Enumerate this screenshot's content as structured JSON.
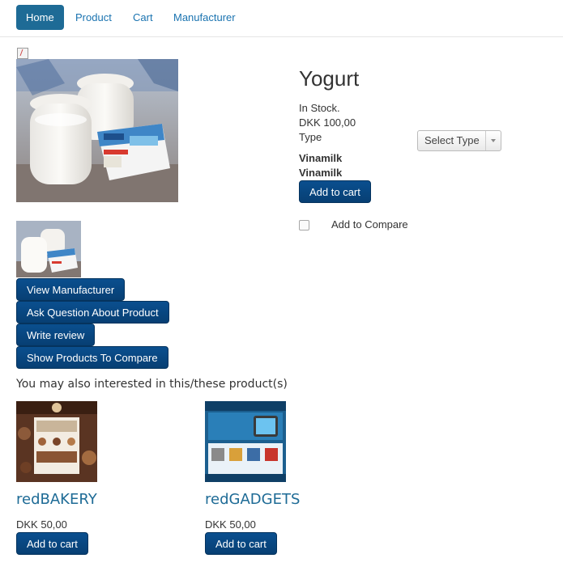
{
  "nav": {
    "items": [
      {
        "label": "Home",
        "active": true
      },
      {
        "label": "Product",
        "active": false
      },
      {
        "label": "Cart",
        "active": false
      },
      {
        "label": "Manufacturer",
        "active": false
      }
    ]
  },
  "product": {
    "title": "Yogurt",
    "stock": "In Stock.",
    "price": "DKK 100,00",
    "type_label": "Type",
    "manufacturer_1": "Vinamilk",
    "manufacturer_2": "Vinamilk",
    "add_to_cart": "Add to cart",
    "type_select": "Select Type",
    "compare_label": "Add to Compare"
  },
  "actions": {
    "view_manufacturer": "View Manufacturer",
    "ask_question": "Ask Question About Product",
    "write_review": "Write review",
    "show_compare": "Show Products To Compare"
  },
  "related": {
    "heading": "You may also interested in this/these product(s)",
    "items": [
      {
        "name": "redBAKERY",
        "price": "DKK 50,00",
        "button": "Add to cart"
      },
      {
        "name": "redGADGETS",
        "price": "DKK 50,00",
        "button": "Add to cart"
      }
    ]
  },
  "colors": {
    "primary_button": "#0a4f8f",
    "nav_active": "#1e6b96",
    "link": "#1a73b0"
  }
}
